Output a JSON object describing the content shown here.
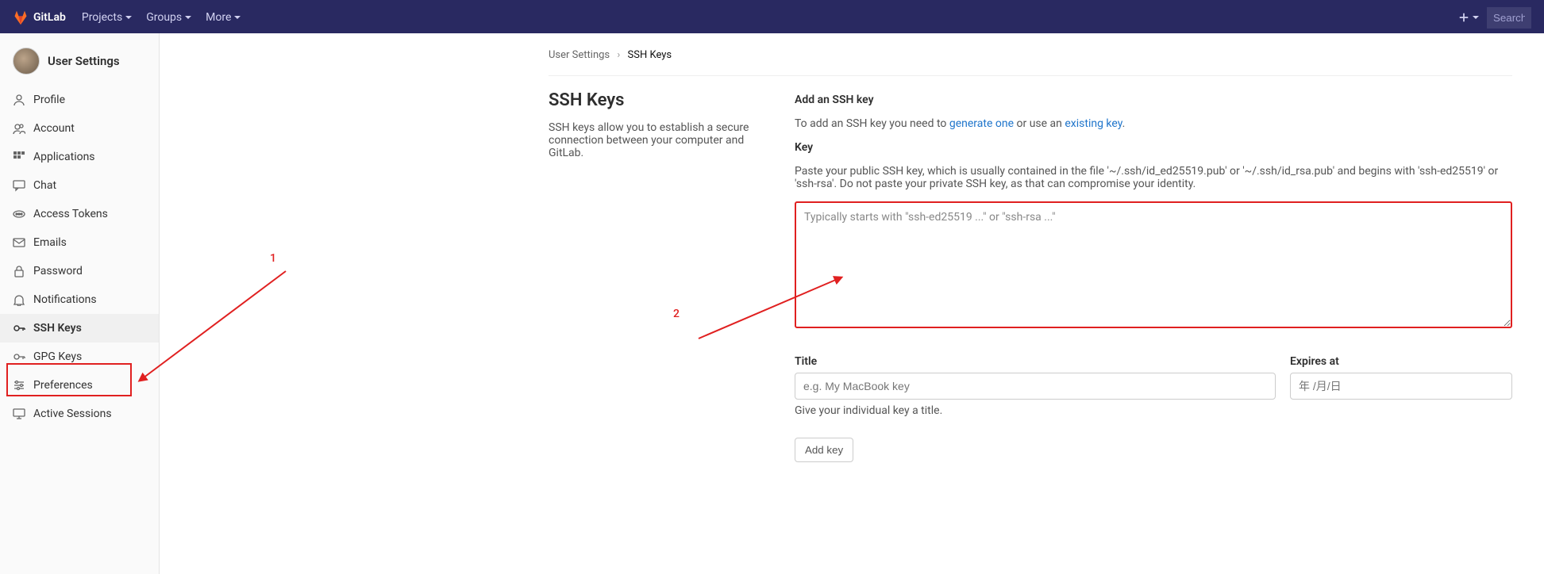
{
  "brand": "GitLab",
  "nav": {
    "projects": "Projects",
    "groups": "Groups",
    "more": "More"
  },
  "search_placeholder": "Search",
  "sidebar": {
    "title": "User Settings",
    "items": [
      {
        "label": "Profile"
      },
      {
        "label": "Account"
      },
      {
        "label": "Applications"
      },
      {
        "label": "Chat"
      },
      {
        "label": "Access Tokens"
      },
      {
        "label": "Emails"
      },
      {
        "label": "Password"
      },
      {
        "label": "Notifications"
      },
      {
        "label": "SSH Keys"
      },
      {
        "label": "GPG Keys"
      },
      {
        "label": "Preferences"
      },
      {
        "label": "Active Sessions"
      }
    ]
  },
  "breadcrumb": {
    "parent": "User Settings",
    "current": "SSH Keys"
  },
  "left": {
    "title": "SSH Keys",
    "desc": "SSH keys allow you to establish a secure connection between your computer and GitLab."
  },
  "right": {
    "add_title": "Add an SSH key",
    "add_text_pre": "To add an SSH key you need to ",
    "generate": "generate one",
    "add_text_mid": " or use an ",
    "existing": "existing key",
    "key_label": "Key",
    "key_hint": "Paste your public SSH key, which is usually contained in the file '~/.ssh/id_ed25519.pub' or '~/.ssh/id_rsa.pub' and begins with 'ssh-ed25519' or 'ssh-rsa'. Do not paste your private SSH key, as that can compromise your identity.",
    "key_placeholder": "Typically starts with \"ssh-ed25519 ...\" or \"ssh-rsa ...\"",
    "title_label": "Title",
    "title_placeholder": "e.g. My MacBook key",
    "title_hint": "Give your individual key a title.",
    "expires_label": "Expires at",
    "expires_placeholder": "年 /月/日",
    "button": "Add key"
  },
  "annotations": {
    "one": "1",
    "two": "2"
  }
}
